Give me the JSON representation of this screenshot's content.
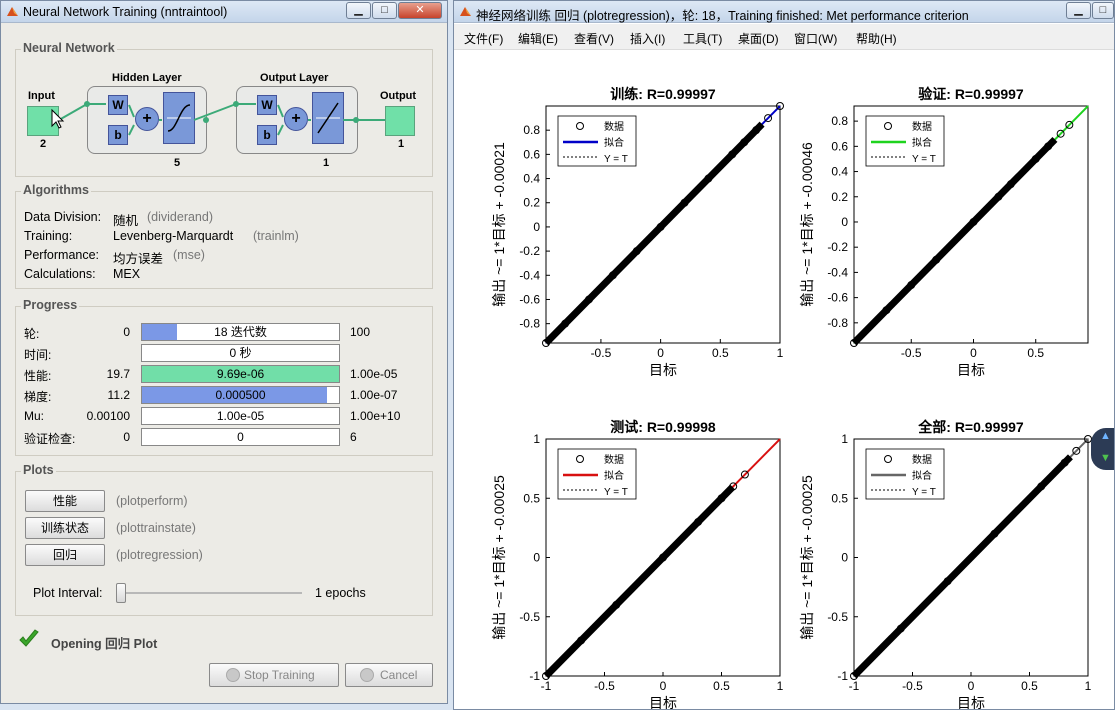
{
  "left_window": {
    "title": "Neural Network Training (nntraintool)",
    "nn": {
      "section": "Neural Network",
      "hidden_label": "Hidden Layer",
      "output_layer_label": "Output Layer",
      "input_label": "Input",
      "input_size": "2",
      "output_label": "Output",
      "output_size": "1",
      "hidden_size": "5",
      "out_size": "1",
      "w": "W",
      "b": "b",
      "plus": "+"
    },
    "algorithms": {
      "section": "Algorithms",
      "rows": [
        {
          "label": "Data Division:",
          "value": "随机",
          "fn": "(dividerand)"
        },
        {
          "label": "Training:",
          "value": "Levenberg-Marquardt",
          "fn": "(trainlm)"
        },
        {
          "label": "Performance:",
          "value": "均方误差",
          "fn": "(mse)"
        },
        {
          "label": "Calculations:",
          "value": "MEX",
          "fn": ""
        }
      ]
    },
    "progress": {
      "section": "Progress",
      "rows": [
        {
          "label": "轮:",
          "start": "0",
          "text": "18 迭代数",
          "end": "100",
          "fill": 0.18,
          "color": "#7b98e6"
        },
        {
          "label": "时间:",
          "start": "",
          "text": "0 秒",
          "end": "",
          "fill": 0,
          "color": "#7b98e6"
        },
        {
          "label": "性能:",
          "start": "19.7",
          "text": "9.69e-06",
          "end": "1.00e-05",
          "fill": 1.0,
          "color": "#71dea8"
        },
        {
          "label": "梯度:",
          "start": "11.2",
          "text": "0.000500",
          "end": "1.00e-07",
          "fill": 0.94,
          "color": "#7b98e6"
        },
        {
          "label": "Mu:",
          "start": "0.00100",
          "text": "1.00e-05",
          "end": "1.00e+10",
          "fill": 0,
          "color": "#7b98e6"
        },
        {
          "label": "验证检查:",
          "start": "0",
          "text": "0",
          "end": "6",
          "fill": 0,
          "color": "#7b98e6"
        }
      ]
    },
    "plots": {
      "section": "Plots",
      "buttons": [
        {
          "label": "性能",
          "fn": "(plotperform)"
        },
        {
          "label": "训练状态",
          "fn": "(plottrainstate)"
        },
        {
          "label": "回归",
          "fn": "(plotregression)"
        }
      ],
      "interval_label": "Plot Interval:",
      "interval_value": "1 epochs"
    },
    "status": "Opening 回归 Plot",
    "stop_label": "Stop Training",
    "cancel_label": "Cancel"
  },
  "right_window": {
    "title": "神经网络训练 回归 (plotregression)，轮: 18，Training finished: Met performance criterion",
    "menu": [
      "文件(F)",
      "编辑(E)",
      "查看(V)",
      "插入(I)",
      "工具(T)",
      "桌面(D)",
      "窗口(W)",
      "帮助(H)"
    ]
  },
  "chart_data": [
    {
      "type": "scatter",
      "title": "训练: R=0.99997",
      "xlabel": "目标",
      "ylabel": "输出 ~= 1*目标 + -0.00021",
      "xlim": [
        -0.96,
        1
      ],
      "ylim": [
        -0.96,
        1
      ],
      "xticks": [
        -0.5,
        0,
        0.5,
        1
      ],
      "yticks": [
        -0.8,
        -0.6,
        -0.4,
        -0.2,
        0,
        0.2,
        0.4,
        0.6,
        0.8
      ],
      "fit_color": "#0000c8",
      "fit": {
        "slope": 1,
        "intercept": -0.00021
      },
      "legend": [
        "数据",
        "拟合",
        "Y = T"
      ],
      "legend_position": "top-left",
      "data": {
        "x": [
          -0.96,
          -0.8,
          -0.6,
          -0.4,
          -0.2,
          0,
          0.2,
          0.4,
          0.6,
          0.7,
          0.8,
          0.9,
          1
        ],
        "y": [
          -0.96,
          -0.8,
          -0.6,
          -0.4,
          -0.2,
          0,
          0.2,
          0.4,
          0.6,
          0.7,
          0.8,
          0.9,
          1
        ]
      }
    },
    {
      "type": "scatter",
      "title": "验证: R=0.99997",
      "xlabel": "目标",
      "ylabel": "输出 ~= 1*目标 + -0.00046",
      "xlim": [
        -0.96,
        0.92
      ],
      "ylim": [
        -0.96,
        0.92
      ],
      "xticks": [
        -0.5,
        0,
        0.5
      ],
      "yticks": [
        -0.8,
        -0.6,
        -0.4,
        -0.2,
        0,
        0.2,
        0.4,
        0.6,
        0.8
      ],
      "fit_color": "#1ed31e",
      "fit": {
        "slope": 1,
        "intercept": -0.00046
      },
      "legend": [
        "数据",
        "拟合",
        "Y = T"
      ],
      "legend_position": "top-left",
      "data": {
        "x": [
          -0.96,
          -0.7,
          -0.5,
          -0.3,
          0,
          0.2,
          0.3,
          0.5,
          0.6,
          0.7,
          0.77
        ],
        "y": [
          -0.96,
          -0.7,
          -0.5,
          -0.3,
          0,
          0.2,
          0.3,
          0.5,
          0.6,
          0.7,
          0.77
        ]
      }
    },
    {
      "type": "scatter",
      "title": "测试: R=0.99998",
      "xlabel": "目标",
      "ylabel": "输出 ~= 1*目标 + -0.00025",
      "xlim": [
        -1,
        1
      ],
      "ylim": [
        -1,
        1
      ],
      "xticks": [
        -1,
        -0.5,
        0,
        0.5,
        1
      ],
      "yticks": [
        -1,
        -0.5,
        0,
        0.5,
        1
      ],
      "fit_color": "#d81010",
      "fit": {
        "slope": 1,
        "intercept": -0.00025
      },
      "legend": [
        "数据",
        "拟合",
        "Y = T"
      ],
      "legend_position": "top-left",
      "data": {
        "x": [
          -1,
          -0.7,
          -0.4,
          0,
          0.3,
          0.5,
          0.6,
          0.7
        ],
        "y": [
          -1,
          -0.7,
          -0.4,
          0,
          0.3,
          0.5,
          0.6,
          0.7
        ]
      }
    },
    {
      "type": "scatter",
      "title": "全部: R=0.99997",
      "xlabel": "目标",
      "ylabel": "输出 ~= 1*目标 + -0.00025",
      "xlim": [
        -1,
        1
      ],
      "ylim": [
        -1,
        1
      ],
      "xticks": [
        -1,
        -0.5,
        0,
        0.5,
        1
      ],
      "yticks": [
        -1,
        -0.5,
        0,
        0.5,
        1
      ],
      "fit_color": "#666666",
      "fit": {
        "slope": 1,
        "intercept": -0.00025
      },
      "legend": [
        "数据",
        "拟合",
        "Y = T"
      ],
      "legend_position": "top-left",
      "data": {
        "x": [
          -1,
          -0.6,
          -0.2,
          0.2,
          0.6,
          0.8,
          0.9,
          1
        ],
        "y": [
          -1,
          -0.6,
          -0.2,
          0.2,
          0.6,
          0.8,
          0.9,
          1
        ]
      }
    }
  ]
}
